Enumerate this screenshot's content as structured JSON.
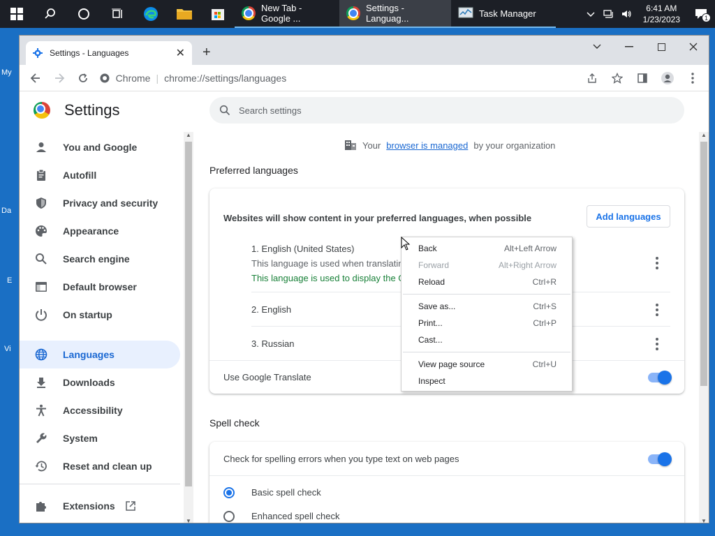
{
  "taskbar": {
    "apps": [
      {
        "label": "New Tab - Google ...",
        "active": false
      },
      {
        "label": "Settings - Languag...",
        "active": true
      },
      {
        "label": "Task Manager",
        "active": false
      }
    ],
    "clock_time": "6:41 AM",
    "clock_date": "1/23/2023",
    "notification_count": "1"
  },
  "desktop_labels": [
    "My",
    "Da",
    "E",
    "Vi"
  ],
  "browser": {
    "tab_title": "Settings - Languages",
    "omnibox_site": "Chrome",
    "omnibox_url": "chrome://settings/languages"
  },
  "settings": {
    "title": "Settings",
    "search_placeholder": "Search settings",
    "nav": [
      {
        "label": "You and Google",
        "icon": "person-icon"
      },
      {
        "label": "Autofill",
        "icon": "clipboard-icon"
      },
      {
        "label": "Privacy and security",
        "icon": "shield-icon"
      },
      {
        "label": "Appearance",
        "icon": "palette-icon"
      },
      {
        "label": "Search engine",
        "icon": "search-icon"
      },
      {
        "label": "Default browser",
        "icon": "browser-icon"
      },
      {
        "label": "On startup",
        "icon": "power-icon"
      },
      {
        "label": "Languages",
        "icon": "globe-icon",
        "active": true
      },
      {
        "label": "Downloads",
        "icon": "download-icon"
      },
      {
        "label": "Accessibility",
        "icon": "accessibility-icon"
      },
      {
        "label": "System",
        "icon": "wrench-icon"
      },
      {
        "label": "Reset and clean up",
        "icon": "history-icon"
      },
      {
        "label": "Extensions",
        "icon": "puzzle-icon"
      }
    ],
    "managed": {
      "prefix": "Your",
      "link": "browser is managed",
      "suffix": "by your organization"
    },
    "preferred": {
      "section_title": "Preferred languages",
      "description": "Websites will show content in your preferred languages, when possible",
      "add_button": "Add languages",
      "languages": [
        {
          "name": "1. English (United States)",
          "sub": "This language is used when translatin",
          "green": "This language is used to display the G"
        },
        {
          "name": "2. English"
        },
        {
          "name": "3. Russian"
        }
      ],
      "translate_label": "Use Google Translate"
    },
    "spell": {
      "section_title": "Spell check",
      "check_label": "Check for spelling errors when you type text on web pages",
      "basic": "Basic spell check",
      "enhanced": "Enhanced spell check"
    }
  },
  "context_menu": [
    {
      "label": "Back",
      "shortcut": "Alt+Left Arrow"
    },
    {
      "label": "Forward",
      "shortcut": "Alt+Right Arrow",
      "disabled": true
    },
    {
      "label": "Reload",
      "shortcut": "Ctrl+R"
    },
    {
      "label": "Save as...",
      "shortcut": "Ctrl+S"
    },
    {
      "label": "Print...",
      "shortcut": "Ctrl+P"
    },
    {
      "label": "Cast...",
      "shortcut": ""
    },
    {
      "label": "View page source",
      "shortcut": "Ctrl+U"
    },
    {
      "label": "Inspect",
      "shortcut": ""
    }
  ]
}
